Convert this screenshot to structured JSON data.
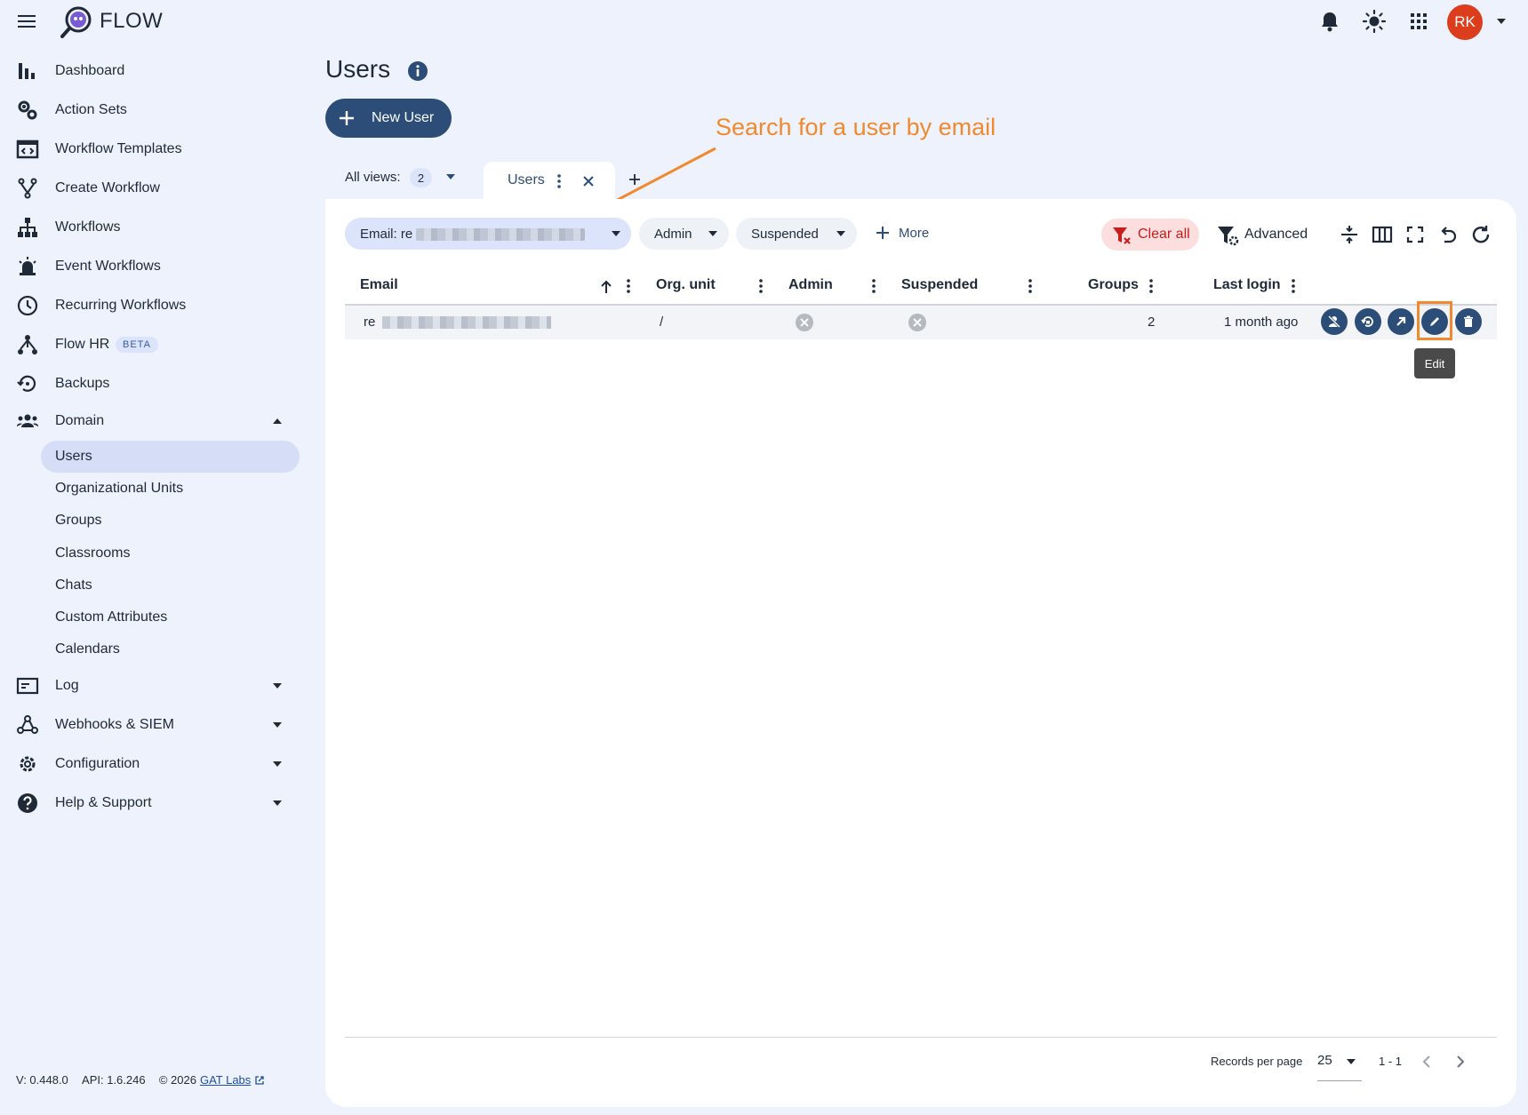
{
  "app": {
    "brand": "FLOW",
    "avatar_initials": "RK"
  },
  "colors": {
    "primary": "#2d4d79",
    "accent": "#f18a2f",
    "avatar": "#dc3d1c",
    "danger": "#c81e1e",
    "background": "#eef2fc"
  },
  "topbar": {
    "icons": [
      "menu-icon",
      "bell-icon",
      "theme-icon",
      "apps-grid-icon"
    ]
  },
  "sidebar": {
    "items": [
      {
        "label": "Dashboard",
        "icon": "bar-chart-icon"
      },
      {
        "label": "Action Sets",
        "icon": "gears-icon"
      },
      {
        "label": "Workflow Templates",
        "icon": "template-icon"
      },
      {
        "label": "Create Workflow",
        "icon": "fork-icon"
      },
      {
        "label": "Workflows",
        "icon": "hierarchy-icon"
      },
      {
        "label": "Event Workflows",
        "icon": "alarm-icon"
      },
      {
        "label": "Recurring Workflows",
        "icon": "clock-icon"
      },
      {
        "label": "Flow HR",
        "icon": "people-network-icon",
        "badge": "BETA"
      },
      {
        "label": "Backups",
        "icon": "backup-icon"
      },
      {
        "label": "Domain",
        "icon": "group-icon"
      }
    ],
    "domain_sub": [
      "Users",
      "Organizational Units",
      "Groups",
      "Classrooms",
      "Chats",
      "Custom Attributes",
      "Calendars"
    ],
    "bottom_items": [
      {
        "label": "Log",
        "icon": "log-icon"
      },
      {
        "label": "Webhooks & SIEM",
        "icon": "webhook-icon"
      },
      {
        "label": "Configuration",
        "icon": "gear-icon"
      },
      {
        "label": "Help & Support",
        "icon": "help-icon"
      }
    ]
  },
  "footer": {
    "version": "V: 0.448.0",
    "api": "API: 1.6.246",
    "copyright": "© 2026",
    "link": "GAT Labs"
  },
  "page": {
    "title": "Users",
    "new_button": "New User"
  },
  "annotation": "Search for a user by email",
  "views": {
    "label": "All views:",
    "count": "2",
    "tab": "Users"
  },
  "filters": {
    "email_label": "Email: re",
    "admin": "Admin",
    "suspended": "Suspended",
    "more": "More",
    "clear_all": "Clear all",
    "advanced": "Advanced"
  },
  "table": {
    "columns": [
      "Email",
      "Org. unit",
      "Admin",
      "Suspended",
      "Groups",
      "Last login"
    ],
    "sort": "Email ascending",
    "rows": [
      {
        "email": "re",
        "org_unit": "/",
        "admin": false,
        "suspended": false,
        "groups": "2",
        "last_login": "1 month ago"
      }
    ]
  },
  "tooltip": "Edit",
  "pagination": {
    "records_label": "Records per page",
    "per_page": "25",
    "range": "1 - 1"
  }
}
